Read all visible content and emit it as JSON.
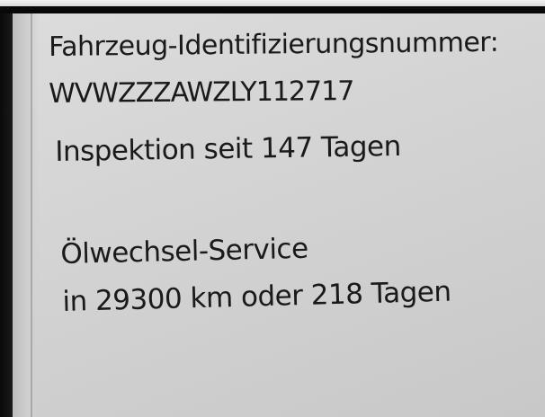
{
  "vehicle_info": {
    "vin_label": "Fahrzeug-Identifizierungsnummer:",
    "vin_value": "WVWZZZAWZLY112717"
  },
  "inspection": {
    "text": "Inspektion seit 147 Tagen"
  },
  "oil_service": {
    "title": "Ölwechsel-Service",
    "detail": "in 29300 km oder 218 Tagen"
  }
}
